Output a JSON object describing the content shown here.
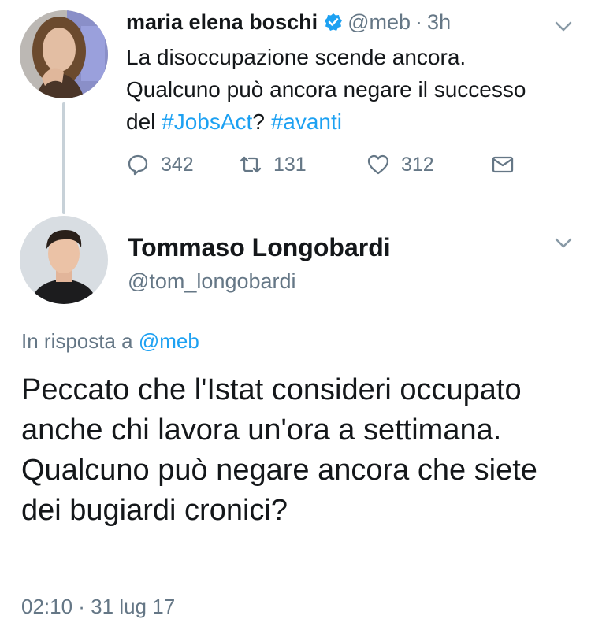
{
  "colors": {
    "text": "#14171a",
    "muted": "#657786",
    "accent": "#1da1f2",
    "thread_line": "#c7d1d8"
  },
  "tweet1": {
    "display_name": "maria elena boschi",
    "verified_icon": "verified-badge-icon",
    "handle": "@meb",
    "separator": "·",
    "time": "3h",
    "text_parts": [
      "La disoccupazione scende ancora.",
      "Qualcuno può ancora negare il successo",
      "del ",
      "#JobsAct",
      "? ",
      "#avanti"
    ],
    "actions": {
      "reply": {
        "icon": "reply-icon",
        "count": "342"
      },
      "retweet": {
        "icon": "retweet-icon",
        "count": "131"
      },
      "like": {
        "icon": "heart-icon",
        "count": "312"
      },
      "dm": {
        "icon": "envelope-icon"
      }
    },
    "menu_icon": "chevron-down-icon"
  },
  "tweet2": {
    "display_name": "Tommaso Longobardi",
    "handle": "@tom_longobardi",
    "menu_icon": "chevron-down-icon",
    "reply_prefix": "In risposta a ",
    "reply_mention": "@meb",
    "text": "Peccato che l'Istat consideri occupato anche chi lavora un'ora a settimana. Qualcuno può negare ancora che siete dei bugiardi cronici?",
    "timestamp": "02:10 · 31 lug 17"
  }
}
